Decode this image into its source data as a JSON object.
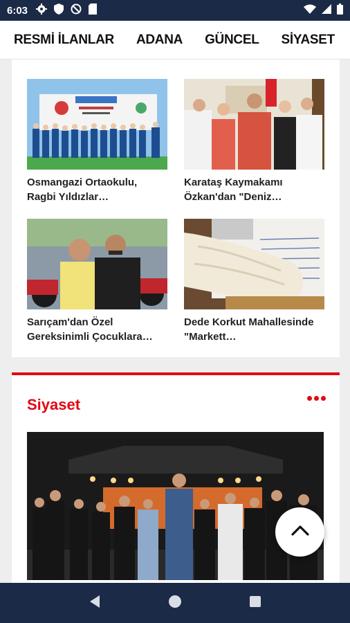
{
  "status_bar": {
    "time": "6:03",
    "left_icons": [
      "gear-icon",
      "shield-icon",
      "no-tracking-icon",
      "sim-card-icon"
    ],
    "right_icons": [
      "wifi-icon",
      "signal-icon",
      "battery-icon"
    ]
  },
  "top_nav": {
    "items": [
      "RESMİ İLANLAR",
      "ADANA",
      "GÜNCEL",
      "SİYASET"
    ]
  },
  "news_cards": [
    {
      "title": "Osmangazi Ortaokulu, Ragbi Yıldızlar…",
      "image": "school-rugby-team-photo"
    },
    {
      "title": "Karataş Kaymakamı Özkan'dan \"Deniz…",
      "image": "district-governor-group-photo"
    },
    {
      "title": "Sarıçam'dan Özel Gereksinimli Çocuklara…",
      "image": "motorcycle-event-photo"
    },
    {
      "title": "Dede Korkut Mahallesinde \"Markett…",
      "image": "bandaged-arm-photo"
    }
  ],
  "section": {
    "title": "Siyaset",
    "more_icon": "more-dots-icon",
    "hero_image": "politicians-on-stage-photo"
  },
  "fab": {
    "icon": "chevron-up-icon"
  },
  "colors": {
    "accent": "#e30613",
    "bars": "#1b2a47"
  },
  "nav_bar": {
    "icons": [
      "back-icon",
      "home-icon",
      "recents-icon"
    ]
  }
}
